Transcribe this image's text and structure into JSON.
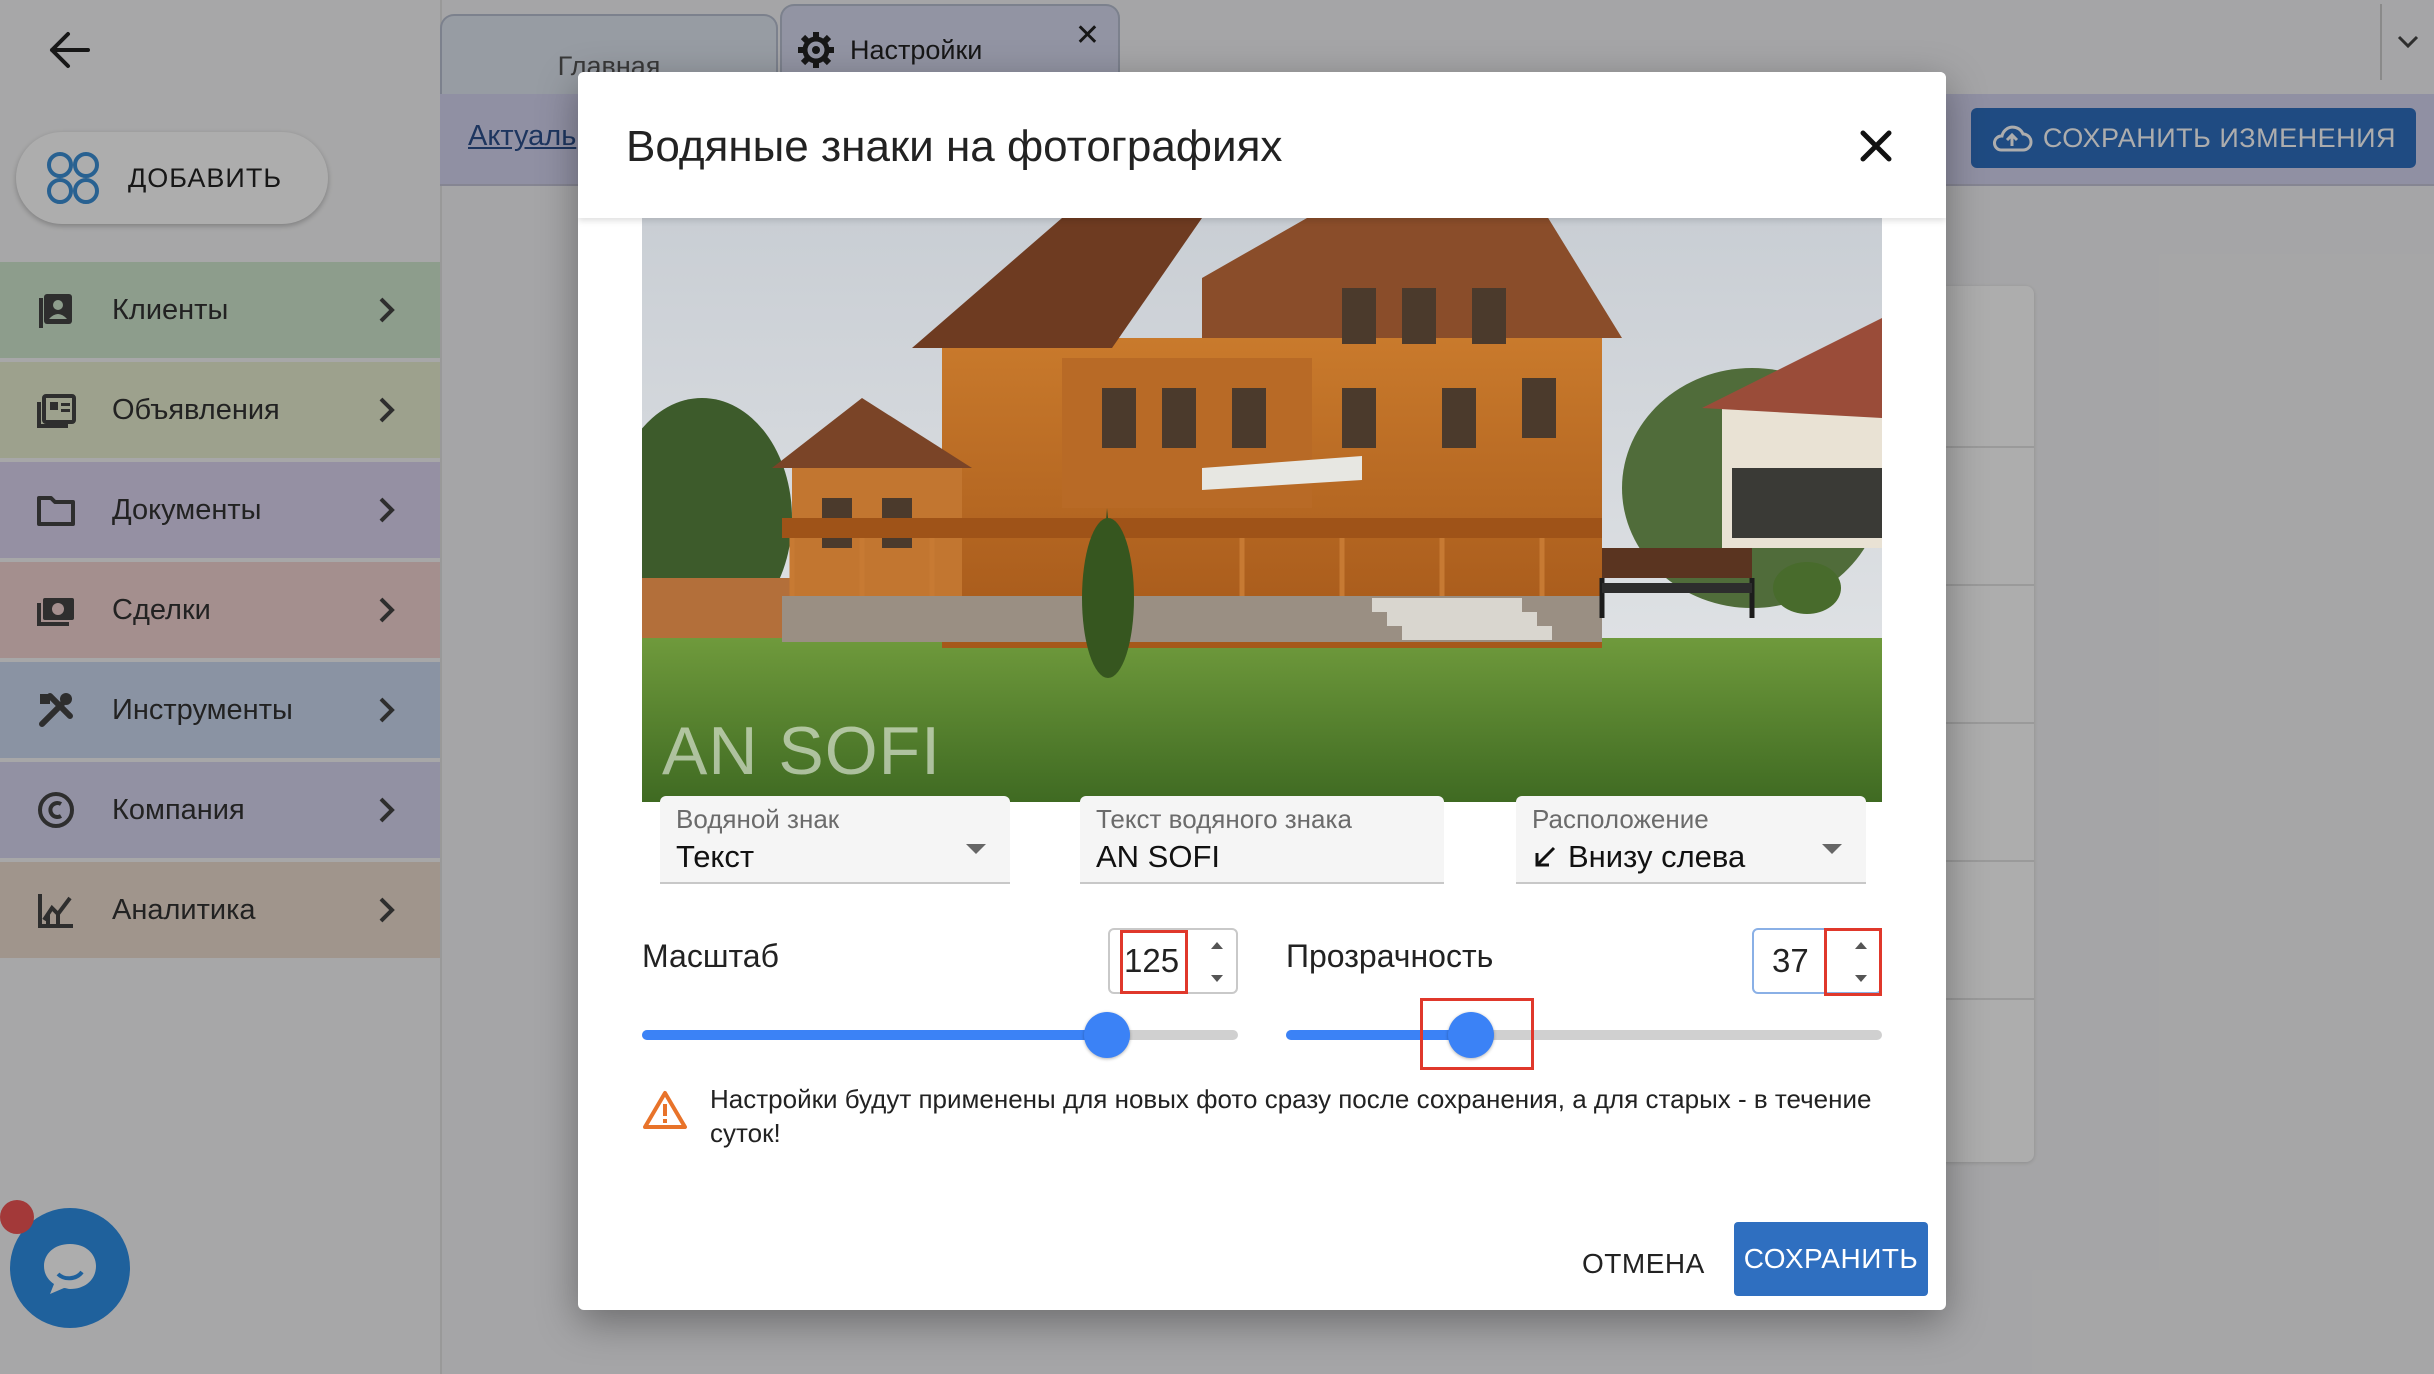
{
  "sidebar": {
    "add_label": "ДОБАВИТЬ",
    "items": [
      {
        "label": "Клиенты",
        "icon": "contacts-icon",
        "color": "#d0e7cf"
      },
      {
        "label": "Объявления",
        "icon": "listings-icon",
        "color": "#e8eed0"
      },
      {
        "label": "Документы",
        "icon": "folder-icon",
        "color": "#dcd4f0"
      },
      {
        "label": "Сделки",
        "icon": "money-icon",
        "color": "#f2d3d1"
      },
      {
        "label": "Инструменты",
        "icon": "tools-icon",
        "color": "#ccd9f0"
      },
      {
        "label": "Компания",
        "icon": "copyright-icon",
        "color": "#d7d6f0"
      },
      {
        "label": "Аналитика",
        "icon": "analytics-icon",
        "color": "#ecdccf"
      }
    ]
  },
  "tabs": {
    "main_label": "Главная",
    "settings_label": "Настройки"
  },
  "subbar": {
    "link_label": "Актуаль",
    "save_changes_label": "СОХРАНИТЬ ИЗМЕНЕНИЯ"
  },
  "dialog": {
    "title": "Водяные знаки на фотографиях",
    "watermark_preview": "AN SOFI",
    "fields": {
      "watermark_type": {
        "label": "Водяной знак",
        "value": "Текст"
      },
      "watermark_text": {
        "label": "Текст водяного знака",
        "value": "AN SOFI"
      },
      "position": {
        "label": "Расположение",
        "value": "Внизу слева",
        "icon": "south-west-arrow-icon"
      }
    },
    "scale": {
      "label": "Масштаб",
      "value": "125",
      "slider_fraction": 0.78
    },
    "opacity": {
      "label": "Прозрачность",
      "value": "37",
      "slider_fraction": 0.31
    },
    "notice": "Настройки будут применены для новых фото сразу после сохранения, а для старых - в течение суток!",
    "cancel_label": "ОТМЕНА",
    "save_label": "СОХРАНИТЬ"
  },
  "colors": {
    "accent": "#2f6fc0",
    "slider": "#3b82f6",
    "highlight": "#e0382b",
    "warning": "#e8732a"
  }
}
